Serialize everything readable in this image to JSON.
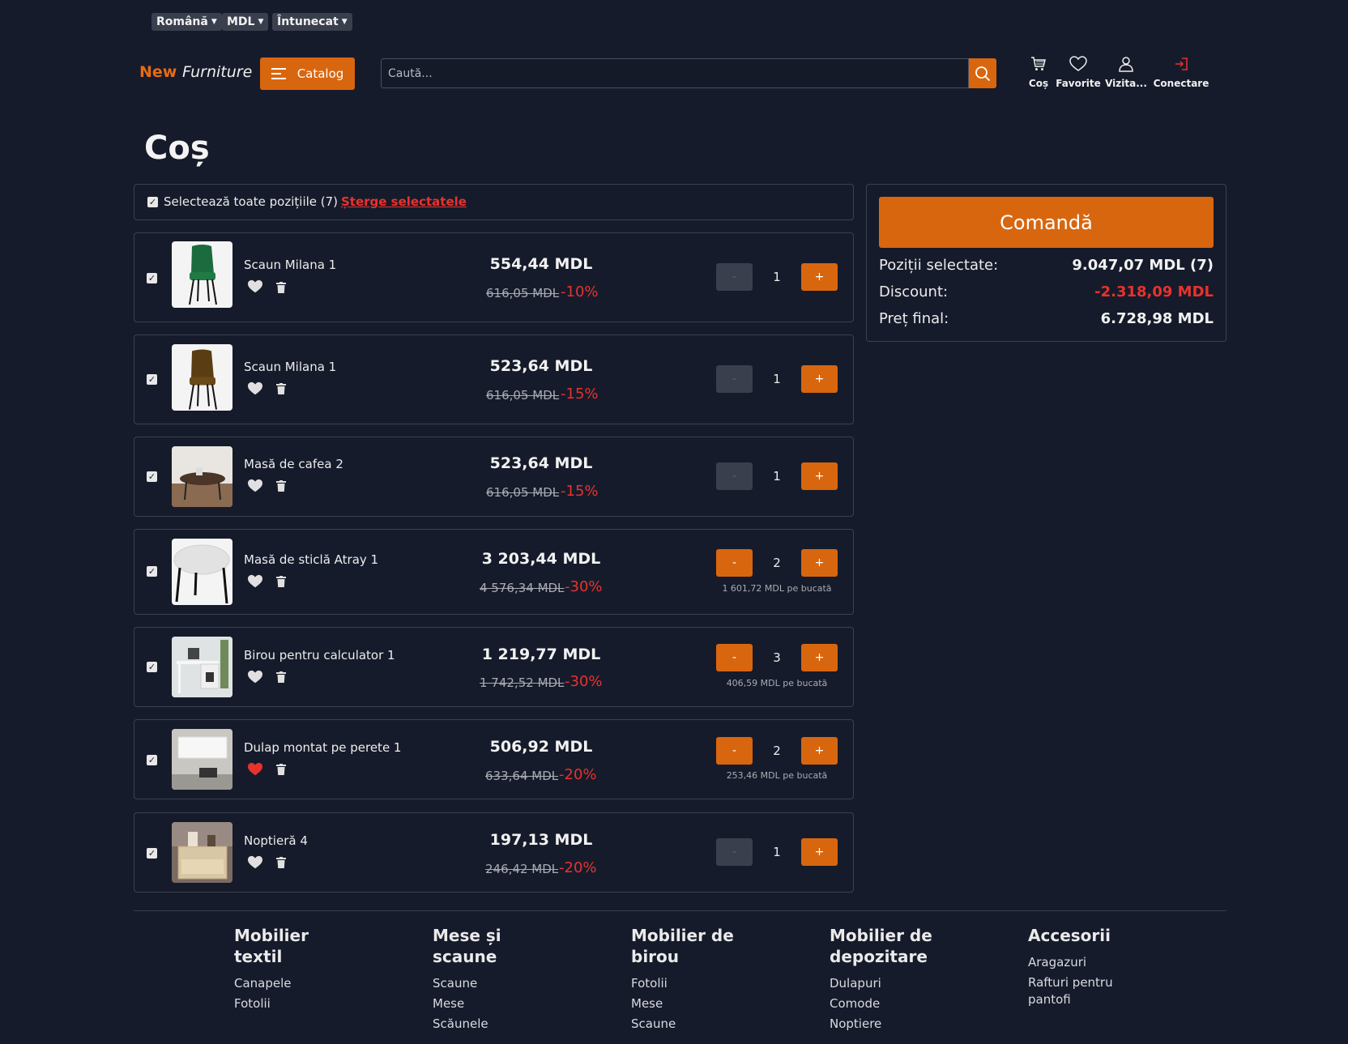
{
  "top_selects": {
    "language": "Română",
    "currency": "MDL",
    "theme": "Întunecat"
  },
  "header": {
    "logo_new": "New",
    "logo_furniture": "Furniture",
    "catalog_label": "Catalog",
    "search_placeholder": "Caută...",
    "icons": [
      {
        "label": "Coș",
        "icon": "cart-icon"
      },
      {
        "label": "Favorite",
        "icon": "heart-icon"
      },
      {
        "label": "Vizita...",
        "icon": "user-icon"
      },
      {
        "label": "Conectare",
        "icon": "login-icon"
      }
    ]
  },
  "page_title": "Coș",
  "cart": {
    "select_all_label": "Selectează toate pozițiile (7)",
    "delete_selected_label": "Șterge selectatele",
    "items": [
      {
        "name": "Scaun Milana 1",
        "price": "554,44 MDL",
        "old_price": "616,05 MDL",
        "discount": "-10%",
        "qty": "1",
        "unit_price": "",
        "favorite": false
      },
      {
        "name": "Scaun Milana 1",
        "price": "523,64 MDL",
        "old_price": "616,05 MDL",
        "discount": "-15%",
        "qty": "1",
        "unit_price": "",
        "favorite": false
      },
      {
        "name": "Masă de cafea 2",
        "price": "523,64 MDL",
        "old_price": "616,05 MDL",
        "discount": "-15%",
        "qty": "1",
        "unit_price": "",
        "favorite": false
      },
      {
        "name": "Masă de sticlă Atray 1",
        "price": "3 203,44 MDL",
        "old_price": "4 576,34 MDL",
        "discount": "-30%",
        "qty": "2",
        "unit_price": "1 601,72 MDL pe bucată",
        "favorite": false
      },
      {
        "name": "Birou pentru calculator 1",
        "price": "1 219,77 MDL",
        "old_price": "1 742,52 MDL",
        "discount": "-30%",
        "qty": "3",
        "unit_price": "406,59 MDL pe bucată",
        "favorite": false
      },
      {
        "name": "Dulap montat pe perete 1",
        "price": "506,92 MDL",
        "old_price": "633,64 MDL",
        "discount": "-20%",
        "qty": "2",
        "unit_price": "253,46 MDL pe bucată",
        "favorite": true
      },
      {
        "name": "Noptieră 4",
        "price": "197,13 MDL",
        "old_price": "246,42 MDL",
        "discount": "-20%",
        "qty": "1",
        "unit_price": "",
        "favorite": false
      }
    ],
    "minus": "-",
    "plus": "+"
  },
  "summary": {
    "order_label": "Comandă",
    "selected_label": "Poziții selectate:",
    "selected_value": "9.047,07 MDL (7)",
    "discount_label": "Discount:",
    "discount_value": "-2.318,09 MDL",
    "final_label": "Preț final:",
    "final_value": "6.728,98 MDL"
  },
  "footer": {
    "columns": [
      {
        "title": "Mobilier textil",
        "links": [
          "Canapele",
          "Fotolii"
        ]
      },
      {
        "title": "Mese și scaune",
        "links": [
          "Scaune",
          "Mese",
          "Scăunele"
        ]
      },
      {
        "title": "Mobilier de birou",
        "links": [
          "Fotolii",
          "Mese",
          "Scaune"
        ]
      },
      {
        "title": "Mobilier de depozitare",
        "links": [
          "Dulapuri",
          "Comode",
          "Noptiere"
        ]
      },
      {
        "title": "Accesorii",
        "links": [
          "Aragazuri",
          "Rafturi pentru pantofi"
        ]
      }
    ]
  },
  "colors": {
    "accent": "#d8660f",
    "background": "#161b2b",
    "discount": "#e8322d"
  }
}
